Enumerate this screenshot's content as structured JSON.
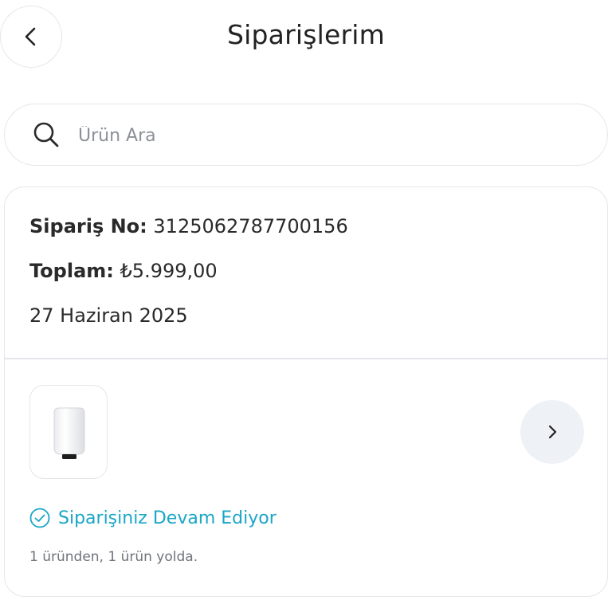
{
  "header": {
    "title": "Siparişlerim",
    "back_icon": "chevron-left-icon"
  },
  "search": {
    "placeholder": "Ürün Ara",
    "icon": "search-icon"
  },
  "order": {
    "order_no_label": "Sipariş No:",
    "order_no_value": "3125062787700156",
    "total_label": "Toplam:",
    "total_value": "₺5.999,00",
    "date": "27 Haziran 2025",
    "product_image": "white-cylindrical-product",
    "detail_icon": "chevron-right-icon",
    "status_icon": "check-circle-icon",
    "status": "Siparişiniz Devam Ediyor",
    "shipment_info": "1 üründen, 1 ürün yolda."
  },
  "colors": {
    "status_accent": "#1aa6c6",
    "border": "#e4e6ea",
    "detail_button_bg": "#eef1f6"
  }
}
